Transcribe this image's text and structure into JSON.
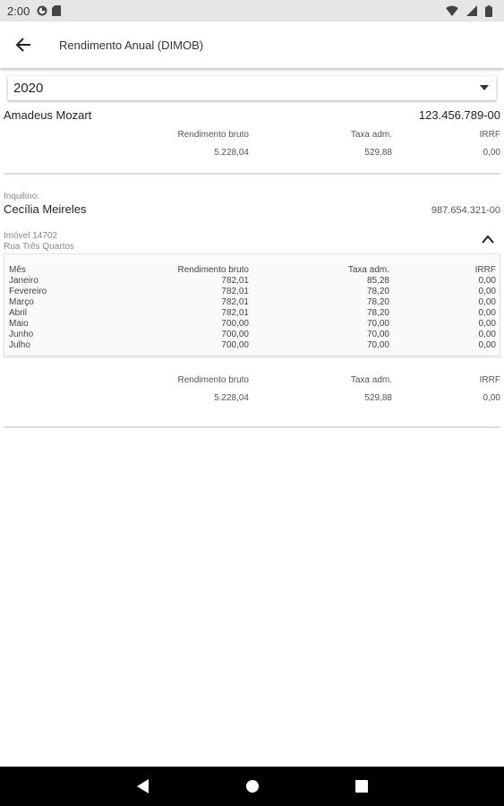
{
  "status_bar": {
    "time": "2:00"
  },
  "app_bar": {
    "title": "Rendimento Anual (DIMOB)",
    "back_icon": "arrow-back-icon"
  },
  "year_select": {
    "value": "2020"
  },
  "owner": {
    "name": "Amadeus Mozart",
    "document": "123.456.789-00",
    "summary_headers": [
      "Rendimento bruto",
      "Taxa adm.",
      "IRRF"
    ],
    "summary_values": [
      "5.228,04",
      "529,88",
      "0,00"
    ]
  },
  "tenant": {
    "label": "Inquilino:",
    "name": "Cecília Meireles",
    "document": "987.654.321-00"
  },
  "property": {
    "label": "Imóvel 14702",
    "address": "Rua Três Quartos",
    "table_headers": [
      "Mês",
      "Rendimento bruto",
      "Taxa adm.",
      "IRRF"
    ],
    "rows": [
      {
        "month": "Janeiro",
        "gross": "782,01",
        "fee": "85,28",
        "irrf": "0,00"
      },
      {
        "month": "Fevereiro",
        "gross": "782,01",
        "fee": "78,20",
        "irrf": "0,00"
      },
      {
        "month": "Março",
        "gross": "782,01",
        "fee": "78,20",
        "irrf": "0,00"
      },
      {
        "month": "Abril",
        "gross": "782,01",
        "fee": "78,20",
        "irrf": "0,00"
      },
      {
        "month": "Maio",
        "gross": "700,00",
        "fee": "70,00",
        "irrf": "0,00"
      },
      {
        "month": "Junho",
        "gross": "700,00",
        "fee": "70,00",
        "irrf": "0,00"
      },
      {
        "month": "Julho",
        "gross": "700,00",
        "fee": "70,00",
        "irrf": "0,00"
      }
    ],
    "summary_headers": [
      "Rendimento bruto",
      "Taxa adm.",
      "IRRF"
    ],
    "summary_values": [
      "5.228,04",
      "529,88",
      "0,00"
    ]
  },
  "nav_bar": {
    "icons": [
      "back-triangle-icon",
      "home-circle-icon",
      "recents-square-icon"
    ]
  }
}
